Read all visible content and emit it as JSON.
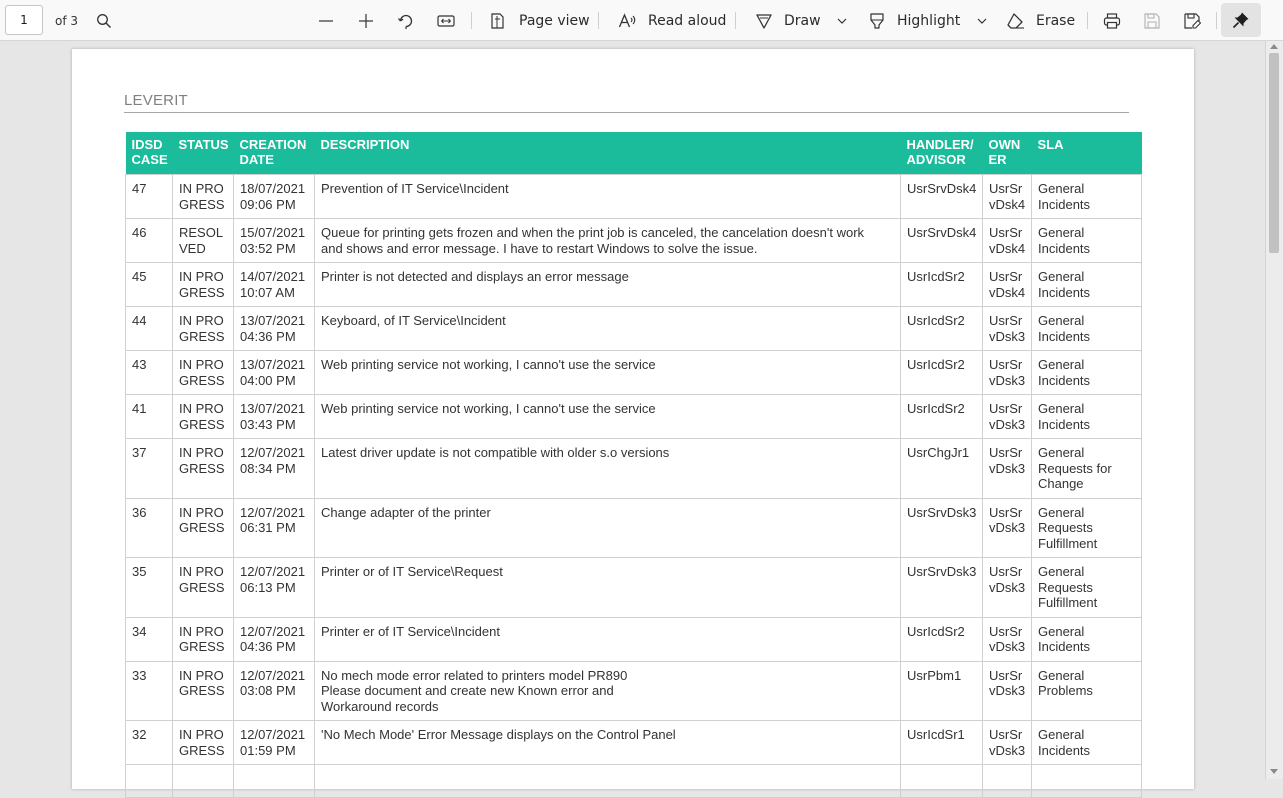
{
  "toolbar": {
    "page_number": "1",
    "page_count_label": "of 3",
    "page_view_label": "Page view",
    "read_aloud_label": "Read aloud",
    "draw_label": "Draw",
    "highlight_label": "Highlight",
    "erase_label": "Erase"
  },
  "document": {
    "company": "LEVERIT",
    "columns": [
      "IDSD\nCASE",
      "STATUS",
      "CREATION\nDATE",
      "DESCRIPTION",
      "HANDLER/\nADVISOR",
      "OWN\nER",
      "SLA"
    ],
    "rows": [
      {
        "id": "47",
        "status": "IN PRO\nGRESS",
        "date": "18/07/2021\n09:06 PM",
        "description": "Prevention of IT Service\\Incident",
        "handler": "UsrSrvDsk4",
        "owner": "UsrSr\nvDsk4",
        "sla": "General\nIncidents"
      },
      {
        "id": "46",
        "status": "RESOL\nVED",
        "date": "15/07/2021\n03:52 PM",
        "description": "Queue for printing gets frozen and when the print job is canceled, the cancelation doesn't work\nand shows and error message. I have to restart Windows to solve the issue.",
        "handler": "UsrSrvDsk4",
        "owner": "UsrSr\nvDsk4",
        "sla": "General\nIncidents"
      },
      {
        "id": "45",
        "status": "IN PRO\nGRESS",
        "date": "14/07/2021\n10:07 AM",
        "description": "Printer is not detected and displays an error message",
        "handler": "UsrIcdSr2",
        "owner": "UsrSr\nvDsk4",
        "sla": "General\nIncidents"
      },
      {
        "id": "44",
        "status": "IN PRO\nGRESS",
        "date": "13/07/2021\n04:36 PM",
        "description": "Keyboard,  of IT Service\\Incident",
        "handler": "UsrIcdSr2",
        "owner": "UsrSr\nvDsk3",
        "sla": "General\nIncidents"
      },
      {
        "id": "43",
        "status": "IN PRO\nGRESS",
        "date": "13/07/2021\n04:00 PM",
        "description": "Web printing service not working, I canno't use the service",
        "handler": "UsrIcdSr2",
        "owner": "UsrSr\nvDsk3",
        "sla": "General\nIncidents"
      },
      {
        "id": "41",
        "status": "IN PRO\nGRESS",
        "date": "13/07/2021\n03:43 PM",
        "description": "Web printing service not working, I canno't use the service",
        "handler": "UsrIcdSr2",
        "owner": "UsrSr\nvDsk3",
        "sla": "General\nIncidents"
      },
      {
        "id": "37",
        "status": "IN PRO\nGRESS",
        "date": "12/07/2021\n08:34 PM",
        "description": "Latest driver update is not compatible with older s.o versions",
        "handler": "UsrChgJr1",
        "owner": "UsrSr\nvDsk3",
        "sla": "General\nRequests for\nChange"
      },
      {
        "id": "36",
        "status": "IN PRO\nGRESS",
        "date": "12/07/2021\n06:31 PM",
        "description": "Change adapter of the printer",
        "handler": "UsrSrvDsk3",
        "owner": "UsrSr\nvDsk3",
        "sla": "General\nRequests\nFulfillment"
      },
      {
        "id": "35",
        "status": "IN PRO\nGRESS",
        "date": "12/07/2021\n06:13 PM",
        "description": "Printer or of IT Service\\Request",
        "handler": "UsrSrvDsk3",
        "owner": "UsrSr\nvDsk3",
        "sla": "General\nRequests\nFulfillment"
      },
      {
        "id": "34",
        "status": "IN PRO\nGRESS",
        "date": "12/07/2021\n04:36 PM",
        "description": "Printer er of IT Service\\Incident",
        "handler": "UsrIcdSr2",
        "owner": "UsrSr\nvDsk3",
        "sla": "General\nIncidents"
      },
      {
        "id": "33",
        "status": "IN PRO\nGRESS",
        "date": "12/07/2021\n03:08 PM",
        "description": "No mech mode error related to printers model PR890\nPlease document and create new Known error and\nWorkaround records",
        "handler": "UsrPbm1",
        "owner": "UsrSr\nvDsk3",
        "sla": "General\nProblems"
      },
      {
        "id": "32",
        "status": "IN PRO\nGRESS",
        "date": "12/07/2021\n01:59 PM",
        "description": "'No Mech Mode' Error Message displays on the Control Panel",
        "handler": "UsrIcdSr1",
        "owner": "UsrSr\nvDsk3",
        "sla": "General\nIncidents"
      },
      {
        "id": "",
        "status": "",
        "date": "",
        "description": "",
        "handler": "",
        "owner": "",
        "sla": ""
      }
    ]
  },
  "colors": {
    "header_bg": "#1abc9c",
    "toolbar_bg": "#f9f9f9",
    "viewer_bg": "#e6e6e6"
  },
  "icons": [
    "search-icon",
    "zoom-out-icon",
    "zoom-in-icon",
    "rotate-icon",
    "fit-width-icon",
    "page-view-icon",
    "read-aloud-icon",
    "draw-icon",
    "chevron-down-icon",
    "highlight-icon",
    "erase-icon",
    "print-icon",
    "save-icon",
    "save-as-icon",
    "pin-icon"
  ]
}
